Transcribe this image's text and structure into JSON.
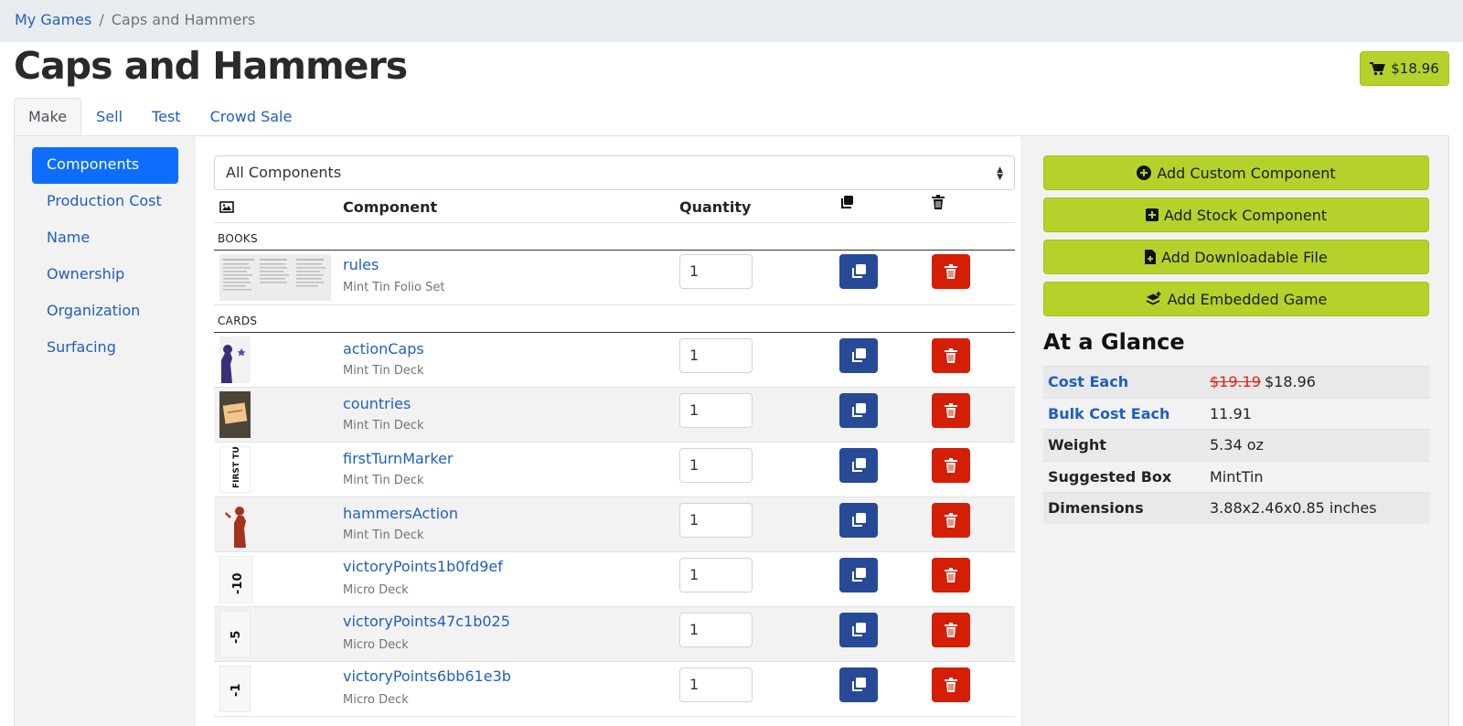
{
  "breadcrumb": {
    "root": "My Games",
    "separator": "/",
    "current": "Caps and Hammers"
  },
  "page": {
    "title": "Caps and Hammers",
    "cart_total": "$18.96"
  },
  "tabs": [
    {
      "label": "Make",
      "active": true
    },
    {
      "label": "Sell"
    },
    {
      "label": "Test"
    },
    {
      "label": "Crowd Sale"
    }
  ],
  "leftnav": [
    {
      "label": "Components",
      "active": true
    },
    {
      "label": "Production Cost"
    },
    {
      "label": "Name"
    },
    {
      "label": "Ownership"
    },
    {
      "label": "Organization"
    },
    {
      "label": "Surfacing"
    }
  ],
  "filter": {
    "selected": "All Components"
  },
  "table": {
    "headers": {
      "image": "image-icon",
      "component": "Component",
      "quantity": "Quantity",
      "duplicate": "copy-icon",
      "delete": "trash-icon"
    },
    "categories": [
      "BOOKS",
      "CARDS"
    ],
    "rows": [
      {
        "name": "rules",
        "type": "Mint Tin Folio Set",
        "quantity": "1"
      },
      {
        "name": "actionCaps",
        "type": "Mint Tin Deck",
        "quantity": "1"
      },
      {
        "name": "countries",
        "type": "Mint Tin Deck",
        "quantity": "1"
      },
      {
        "name": "firstTurnMarker",
        "type": "Mint Tin Deck",
        "quantity": "1",
        "thumb_text": "FIRST TURN"
      },
      {
        "name": "hammersAction",
        "type": "Mint Tin Deck",
        "quantity": "1"
      },
      {
        "name": "victoryPoints1b0fd9ef",
        "type": "Micro Deck",
        "quantity": "1",
        "thumb_text": "-10"
      },
      {
        "name": "victoryPoints47c1b025",
        "type": "Micro Deck",
        "quantity": "1",
        "thumb_text": "-5"
      },
      {
        "name": "victoryPoints6bb61e3b",
        "type": "Micro Deck",
        "quantity": "1",
        "thumb_text": "-1"
      }
    ]
  },
  "actions": [
    {
      "label": "Add Custom Component",
      "icon": "plus-circle-icon"
    },
    {
      "label": "Add Stock Component",
      "icon": "plus-square-icon"
    },
    {
      "label": "Add Downloadable File",
      "icon": "file-plus-icon"
    },
    {
      "label": "Add Embedded Game",
      "icon": "layers-plus-icon"
    }
  ],
  "glance": {
    "title": "At a Glance",
    "cost_each": {
      "label": "Cost Each",
      "old": "$19.19",
      "value": "$18.96"
    },
    "bulk_cost_each": {
      "label": "Bulk Cost Each",
      "value": "11.91"
    },
    "weight": {
      "label": "Weight",
      "value": "5.34 oz"
    },
    "suggested_box": {
      "label": "Suggested Box",
      "value": "MintTin"
    },
    "dimensions": {
      "label": "Dimensions",
      "value": "3.88x2.46x0.85 inches"
    }
  },
  "colors": {
    "accent": "#b5d22b",
    "primary": "#0d6efd",
    "duplicate": "#274a96",
    "delete": "#d41e05",
    "link": "#1f5fbf"
  }
}
